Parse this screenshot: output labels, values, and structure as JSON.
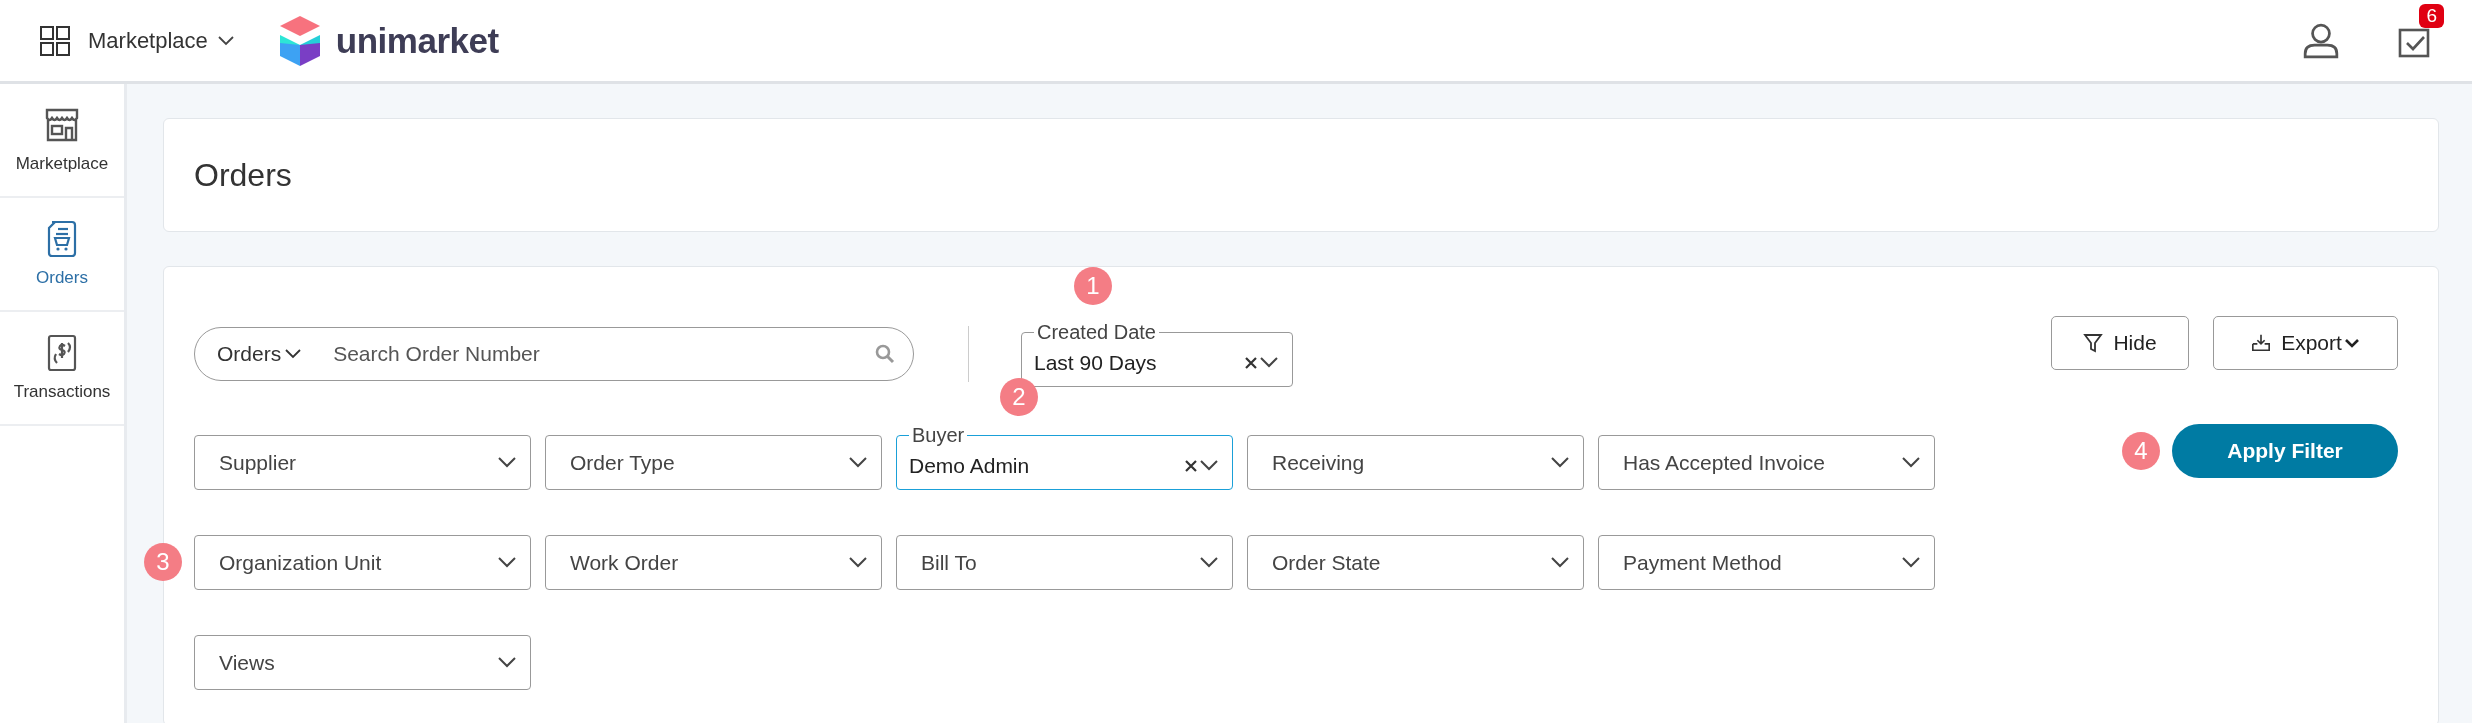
{
  "topbar": {
    "menu_label": "Marketplace",
    "brand": "unimarket",
    "task_count": "6"
  },
  "sidebar": {
    "items": [
      {
        "label": "Marketplace",
        "selected": false
      },
      {
        "label": "Orders",
        "selected": true
      },
      {
        "label": "Transactions",
        "selected": false
      }
    ]
  },
  "page_title": "Orders",
  "search": {
    "scope": "Orders",
    "placeholder": "Search Order Number"
  },
  "created_date": {
    "label": "Created Date",
    "value": "Last 90 Days",
    "marker": "1"
  },
  "actions": [
    {
      "label": "Hide",
      "kind": "filter"
    },
    {
      "label": "Export",
      "kind": "export"
    }
  ],
  "apply_button": {
    "label": "Apply Filter",
    "marker": "4"
  },
  "filter_rows": [
    [
      {
        "label": "Supplier",
        "focused": false
      },
      {
        "label": "Order Type",
        "focused": false
      },
      {
        "label": "Buyer",
        "value": "Demo Admin",
        "focused": true,
        "marker": "2"
      },
      {
        "label": "Receiving",
        "focused": false
      },
      {
        "label": "Has Accepted Invoice",
        "focused": false
      }
    ],
    [
      {
        "label": "Organization Unit",
        "focused": false,
        "marker": "3"
      },
      {
        "label": "Work Order",
        "focused": false
      },
      {
        "label": "Bill To",
        "focused": false
      },
      {
        "label": "Order State",
        "focused": false
      },
      {
        "label": "Payment Method",
        "focused": false
      }
    ],
    [
      {
        "label": "Views",
        "focused": false
      }
    ]
  ]
}
